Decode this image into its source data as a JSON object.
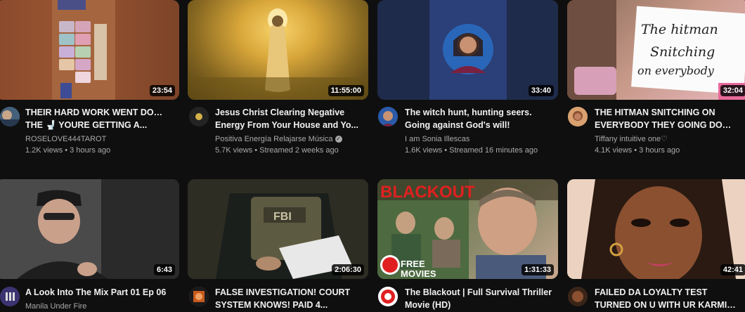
{
  "videos": [
    {
      "title_line1": "THEIR HARD WORK WENT DOWN",
      "title_line2": "THE 🚽 YOURE GETTING A...",
      "channel": "ROSELOVE444TAROT",
      "views": "1.2K views",
      "age": "3 hours ago",
      "duration": "23:54"
    },
    {
      "title_line1": "Jesus Christ Clearing Negative",
      "title_line2": "Energy From Your House and Yo...",
      "channel": "Positiva Energía Relajarse Música",
      "views": "5.7K views",
      "age": "Streamed 2 weeks ago",
      "duration": "11:55:00"
    },
    {
      "title_line1": "The witch hunt, hunting seers.",
      "title_line2": "Going against God's will!",
      "channel": "I am Sonia Illescas",
      "views": "1.6K views",
      "age": "Streamed 16 minutes ago",
      "duration": "33:40"
    },
    {
      "title_line1": "THE HITMAN SNITCHING ON",
      "title_line2": "EVERYBODY THEY GOING DOWN...",
      "channel": "Tiffany intuitive one♡",
      "views": "4.1K views",
      "age": "3 hours ago",
      "duration": "32:04",
      "thumb_text": [
        "The hitman",
        "Snitching",
        "on everybody"
      ]
    },
    {
      "title_line1": "A Look Into The Mix Part 01 Ep 06",
      "title_line2": "",
      "channel": "Manila Under Fire",
      "duration": "6:43"
    },
    {
      "title_line1": "FALSE INVESTIGATION! COURT",
      "title_line2": "SYSTEM KNOWS! PAID 4...",
      "channel": "",
      "duration": "2:06:30",
      "thumb_text": [
        "FBI"
      ]
    },
    {
      "title_line1": "The Blackout | Full Survival Thriller",
      "title_line2": "Movie (HD)",
      "channel": "",
      "duration": "1:31:33",
      "thumb_text": [
        "BLACKOUT",
        "FREE",
        "MOVIES"
      ]
    },
    {
      "title_line1": "FAILED DA LOYALTY TEST",
      "title_line2": "TURNED ON U WITH UR KARMIC...",
      "channel": "",
      "duration": "42:41"
    }
  ],
  "separator": " • ",
  "colors": {
    "background": "#0f0f0f",
    "title": "#f1f1f1",
    "secondary": "#aaaaaa"
  }
}
